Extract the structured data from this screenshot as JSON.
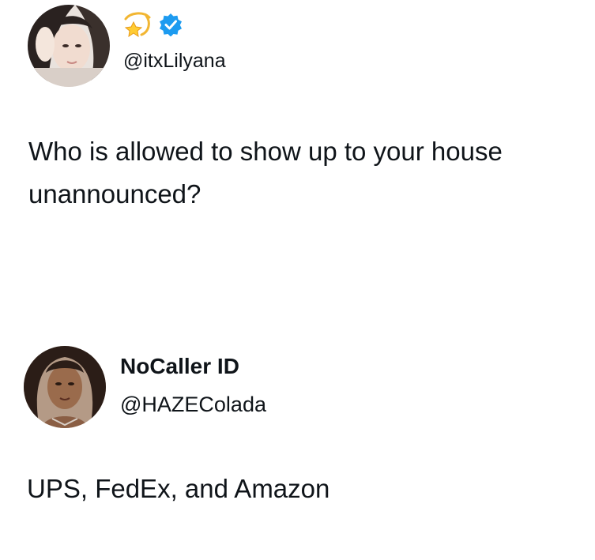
{
  "tweet": {
    "display_name_emoji": "dizzy-star-emoji",
    "verified_badge": "verified-check-icon",
    "handle": "@itxLilyana",
    "text_line1": "Who is allowed to show up to your house",
    "text_line2": "unannounced?"
  },
  "reply": {
    "display_name": "NoCaller ID",
    "handle": "@HAZEColada",
    "text": "UPS, FedEx, and Amazon"
  },
  "colors": {
    "text": "#0f1419",
    "verified_blue": "#1d9bf0",
    "background": "#ffffff"
  }
}
